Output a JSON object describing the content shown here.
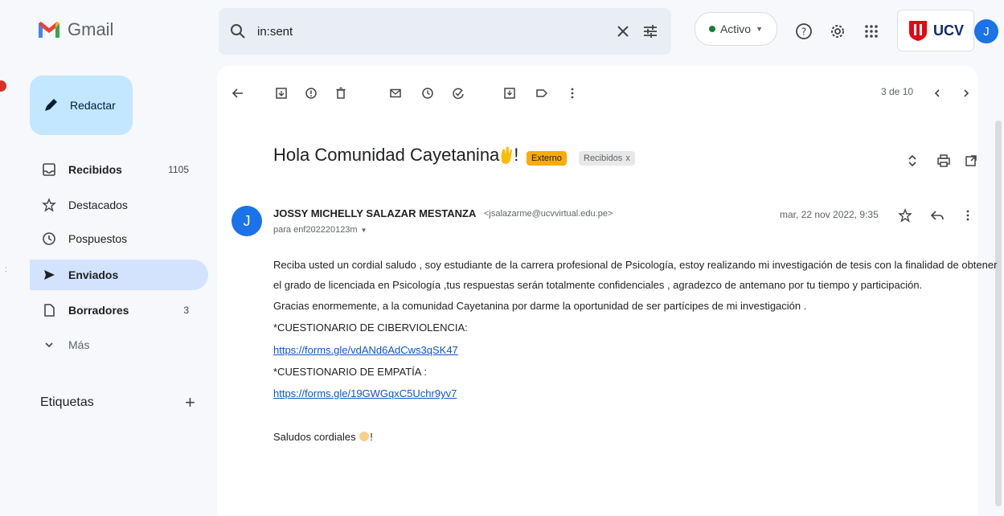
{
  "app": {
    "name": "Gmail"
  },
  "search": {
    "query": "in:sent"
  },
  "status": {
    "label": "Activo"
  },
  "brand": {
    "text": "UCV"
  },
  "user": {
    "avatar_letter": "J"
  },
  "sidebar": {
    "compose_label": "Redactar",
    "items": [
      {
        "label": "Recibidos",
        "count": "1105"
      },
      {
        "label": "Destacados",
        "count": ""
      },
      {
        "label": "Pospuestos",
        "count": ""
      },
      {
        "label": "Enviados",
        "count": ""
      },
      {
        "label": "Borradores",
        "count": "3"
      },
      {
        "label": "Más",
        "count": ""
      }
    ],
    "labels_title": "Etiquetas",
    "labels_add": "+"
  },
  "toolbar": {
    "pager": "3 de 10"
  },
  "email": {
    "subject": "Hola Comunidad Cayetanina",
    "subject_suffix": "!",
    "badges": {
      "external": "Externo",
      "inbox": "Recibidos",
      "inbox_close": "x"
    },
    "sender": {
      "avatar_letter": "J",
      "name": "JOSSY MICHELLY SALAZAR MESTANZA",
      "email": "<jsalazarme@ucvvirtual.edu.pe>"
    },
    "recipient": "para enf202220123m",
    "date": "mar, 22 nov 2022, 9:35",
    "body": [
      "Reciba usted un cordial saludo , soy estudiante de la carrera profesional de Psicología, estoy realizando mi investigación de tesis con la finalidad de obtener",
      "el grado de licenciada en Psicología ,tus respuestas serán totalmente confidenciales  , agradezco de antemano  por tu tiempo y participación.",
      "Gracias enormemente, a la comunidad Cayetanina por darme la oportunidad de ser partícipes de mi  investigación .",
      "*CUESTIONARIO DE CIBERVIOLENCIA:"
    ],
    "link1": "https://forms.gle/vdANd6AdCws3qSK47",
    "section2": "*CUESTIONARIO DE EMPATÍA :",
    "link2": "https://forms.gle/19GWGqxC5Uchr9yv7",
    "closing": "Saludos cordiales",
    "closing_suffix": "!"
  },
  "colors": {
    "accent": "#c2e7ff",
    "active_nav": "#d3e3fd",
    "avatar": "#1a73e8",
    "external_badge": "#f9ab00"
  }
}
